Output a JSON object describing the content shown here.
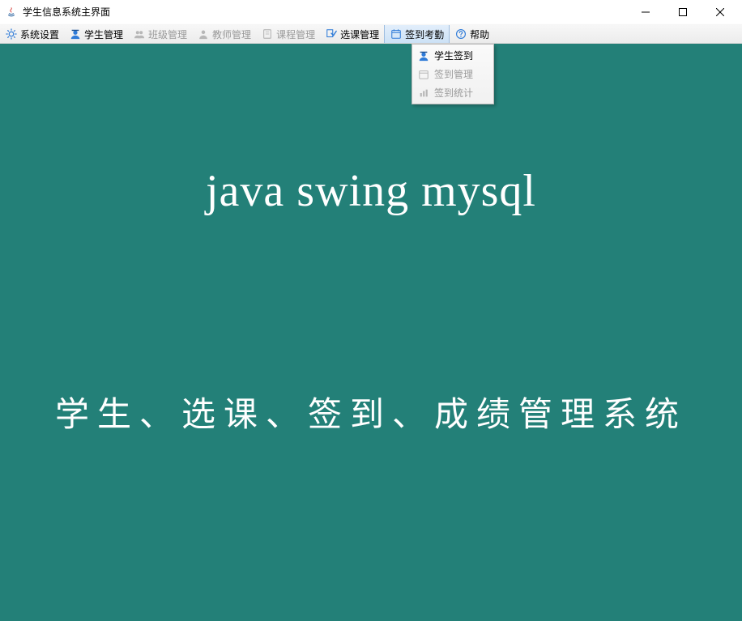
{
  "window": {
    "title": "学生信息系统主界面"
  },
  "toolbar": {
    "items": [
      {
        "label": "系统设置",
        "icon": "gear",
        "enabled": true
      },
      {
        "label": "学生管理",
        "icon": "student",
        "enabled": true
      },
      {
        "label": "班级管理",
        "icon": "people",
        "enabled": false
      },
      {
        "label": "教师管理",
        "icon": "teacher",
        "enabled": false
      },
      {
        "label": "课程管理",
        "icon": "book",
        "enabled": false
      },
      {
        "label": "选课管理",
        "icon": "select",
        "enabled": true
      },
      {
        "label": "签到考勤",
        "icon": "calendar",
        "enabled": true,
        "active": true
      },
      {
        "label": "帮助",
        "icon": "help",
        "enabled": true
      }
    ]
  },
  "dropdown": {
    "items": [
      {
        "label": "学生签到",
        "icon": "student",
        "enabled": true
      },
      {
        "label": "签到管理",
        "icon": "calendar",
        "enabled": false
      },
      {
        "label": "签到统计",
        "icon": "chart",
        "enabled": false
      }
    ]
  },
  "content": {
    "line1": "java swing mysql",
    "line2": "学生、选课、签到、成绩管理系统"
  }
}
